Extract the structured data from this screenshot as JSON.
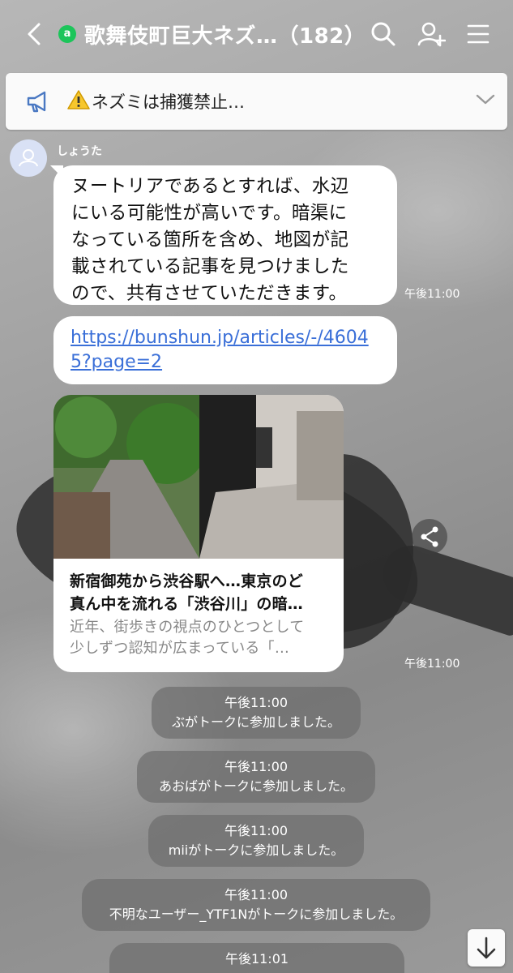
{
  "header": {
    "title": "歌舞伎町巨大ネズ…（182）",
    "badge_glyph": "a",
    "icons": [
      "back-arrow-icon",
      "search-icon",
      "add-friend-icon",
      "menu-icon"
    ]
  },
  "notice": {
    "text": "ネズミは捕獲禁止…",
    "icons": [
      "megaphone-icon",
      "warning-icon",
      "chevron-down-icon"
    ]
  },
  "messages": [
    {
      "sender": "しょうた",
      "text_lines": [
        "ヌートリアであるとすれば、水辺",
        "にいる可能性が高いです。暗渠に",
        "なっている箇所を含め、地図が記",
        "載されている記事を見つけました",
        "ので、共有させていただきます。"
      ],
      "time": "午後11:00"
    },
    {
      "link": "https://bunshun.jp/articles/-/46045?page=2"
    },
    {
      "preview_title": "新宿御苑から渋谷駅へ…東京のど真ん中を流れる「渋谷川」の暗…",
      "preview_title_lines": [
        "新宿御苑から渋谷駅へ…東京のど",
        "真ん中を流れる「渋谷川」の暗…"
      ],
      "preview_desc_lines": [
        "近年、街歩きの視点のひとつとして",
        "少しずつ認知が広まっている「…"
      ],
      "time": "午後11:00"
    }
  ],
  "system_messages": [
    {
      "time": "午後11:00",
      "text": "ぶがトークに参加しました。"
    },
    {
      "time": "午後11:00",
      "text": "あおばがトークに参加しました。"
    },
    {
      "time": "午後11:00",
      "text": "miiがトークに参加しました。"
    },
    {
      "time": "午後11:00",
      "text": "不明なユーザー_YTF1Nがトークに参加しました。"
    },
    {
      "time": "午後11:01",
      "text": ""
    }
  ],
  "colors": {
    "accent_green": "#1cc55a",
    "link_blue": "#3a6fd8",
    "bubble": "#ffffff"
  }
}
